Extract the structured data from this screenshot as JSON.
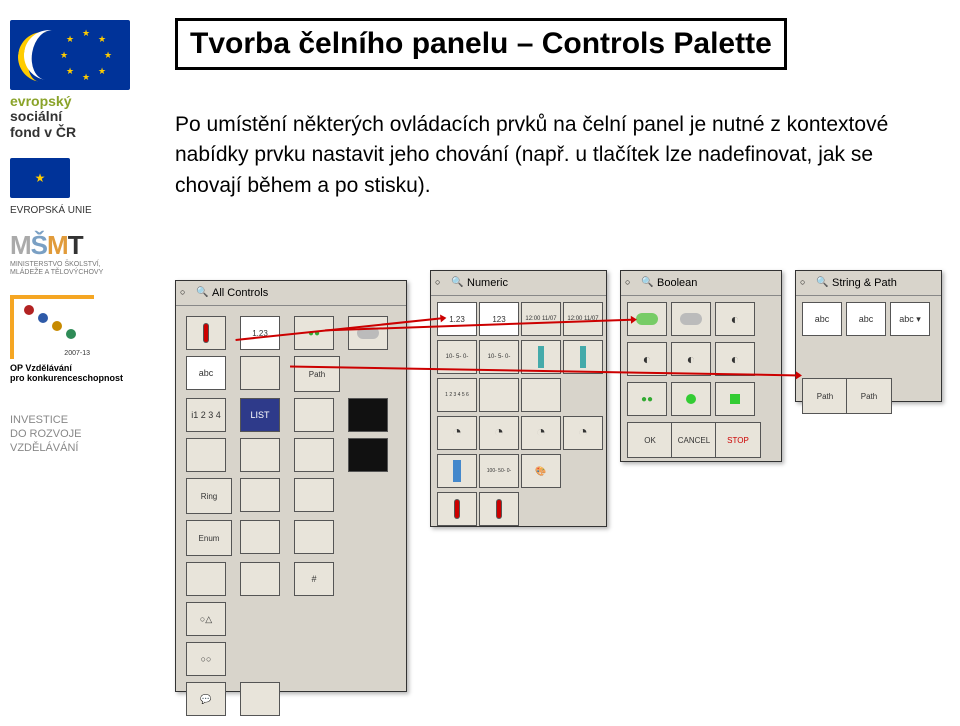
{
  "sidebar": {
    "esf": {
      "line1": "evropský",
      "line2": "sociální",
      "line3": "fond v ČR"
    },
    "eu_label": "EVROPSKÁ UNIE",
    "msmt_sub": "MINISTERSTVO ŠKOLSTVÍ,\nMLÁDEŽE A TĚLOVÝCHOVY",
    "op_year": "2007-13",
    "op_title1": "OP Vzdělávání",
    "op_title2": "pro konkurenceschopnost",
    "invest1": "INVESTICE",
    "invest2": "DO ROZVOJE",
    "invest3": "VZDĚLÁVÁNÍ"
  },
  "title": "Tvorba čelního panelu – Controls Palette",
  "body": "Po umístění některých ovládacích prvků na čelní panel je nutné z kontextové nabídky prvku nastavit jeho chování (např. u tlačítek lze nadefinovat, jak se chovají během a po stisku).",
  "palettes": {
    "all_controls": {
      "title": "All Controls",
      "items": [
        "1.23",
        "",
        "",
        "",
        "",
        "",
        "",
        "abc",
        "",
        "",
        "Path",
        "i1 2 3 4",
        "LIST",
        "",
        "",
        "",
        "",
        "Ring",
        "",
        "",
        "Enum",
        "",
        "",
        "",
        "#",
        "",
        "",
        "",
        "",
        "",
        "",
        ""
      ]
    },
    "numeric": {
      "title": "Numeric",
      "items": [
        "1.23",
        "123",
        "12:00 11/07",
        "12:00 11/07",
        "10- 5- 0-",
        "10- 5- 0-",
        "",
        "",
        "",
        "",
        "",
        "",
        "1 2 3 4 5 6",
        "",
        "",
        "",
        "",
        "",
        "",
        "",
        "100- 50- 0-",
        ""
      ]
    },
    "boolean": {
      "title": "Boolean",
      "items": [
        "",
        "",
        "",
        "",
        "",
        "",
        "",
        "",
        "",
        "",
        "",
        "",
        "",
        "",
        "OK",
        "CANCEL",
        "STOP"
      ]
    },
    "string_path": {
      "title": "String & Path",
      "items": [
        "abc",
        "abc",
        "abc ▾",
        "",
        "",
        "Path",
        "Path"
      ]
    }
  }
}
